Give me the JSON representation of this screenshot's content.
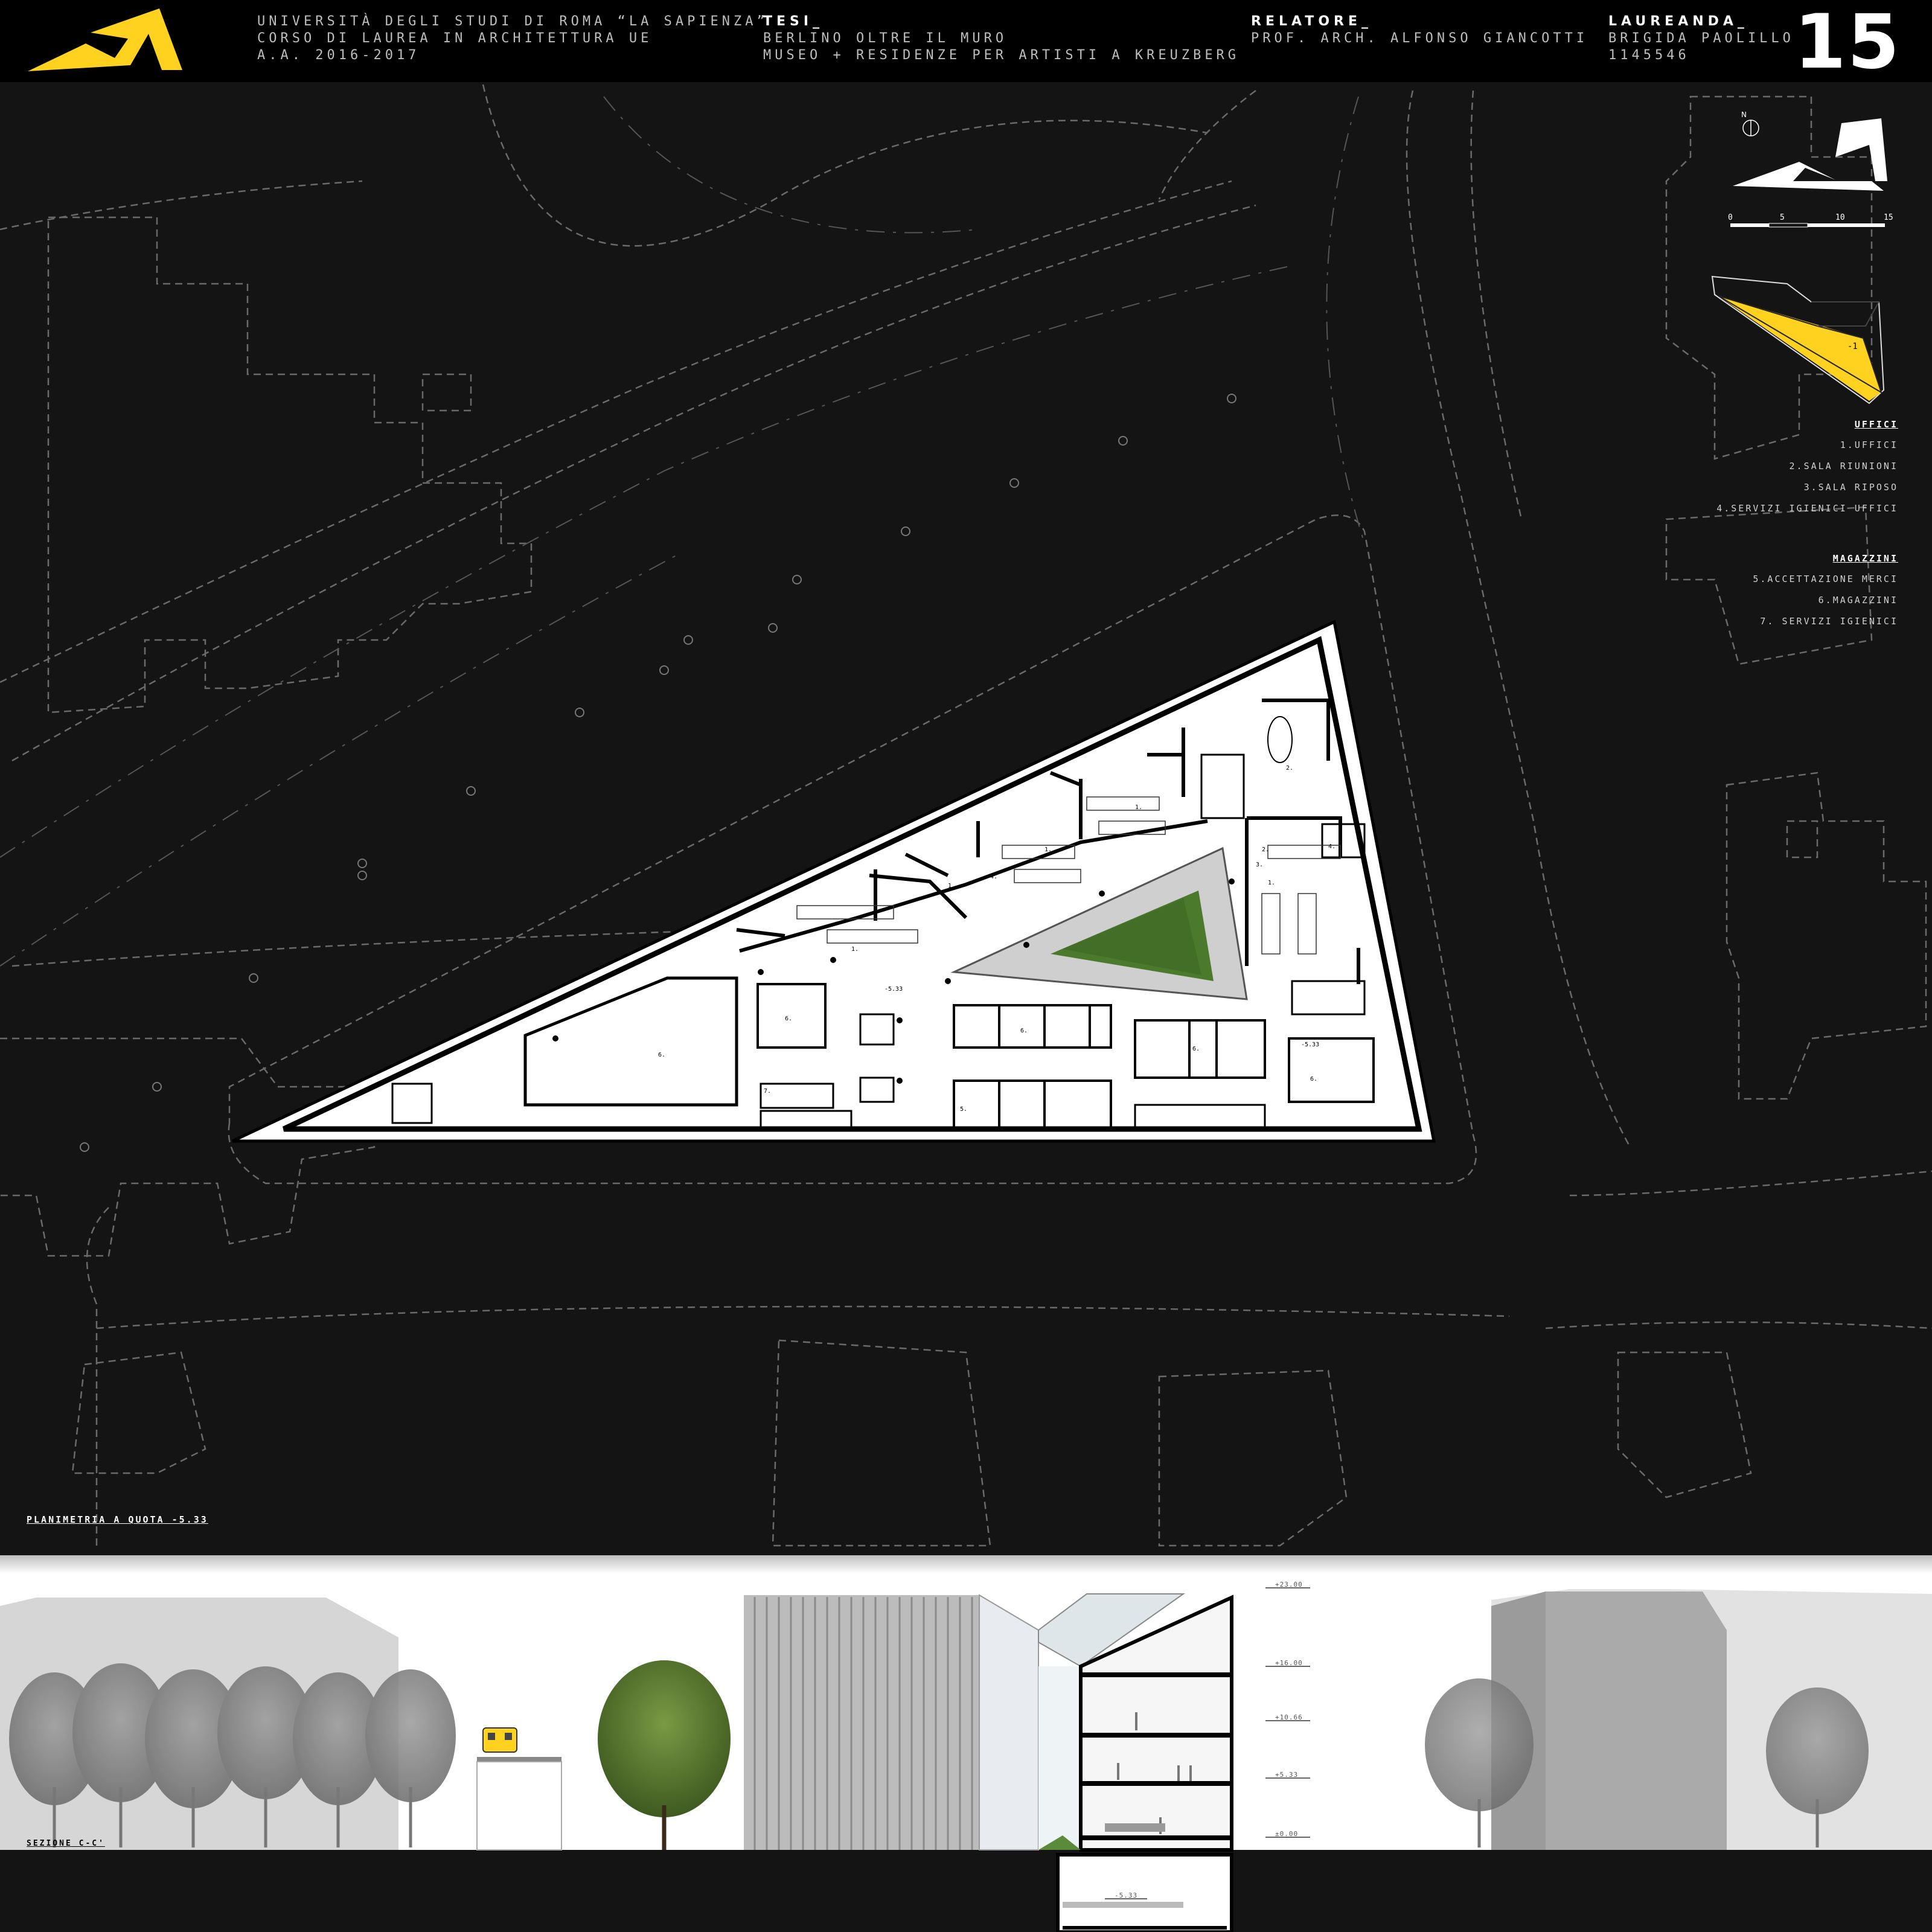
{
  "header": {
    "university": [
      "UNIVERSITÀ DEGLI STUDI DI ROMA “LA SAPIENZA”",
      "CORSO DI LAUREA IN ARCHITETTURA UE",
      "A.A. 2016-2017"
    ],
    "tesi_heading": "TESI_",
    "tesi_lines": [
      "BERLINO OLTRE IL MURO",
      "MUSEO + RESIDENZE PER ARTISTI A KREUZBERG"
    ],
    "relatore_heading": "RELATORE_",
    "relatore_name": "PROF. ARCH. ALFONSO GIANCOTTI",
    "laureanda_heading": "LAUREANDA_",
    "laureanda_name": "BRIGIDA PAOLILLO",
    "laureanda_id": "1145546",
    "page_number": "15"
  },
  "scale_bar": {
    "north": "N",
    "ticks": [
      "0",
      "5",
      "10",
      "15"
    ]
  },
  "key_plan": {
    "level": "-1"
  },
  "legend": {
    "uffici_heading": "UFFICI",
    "uffici_items": [
      "1.UFFICI",
      "2.SALA RIUNIONI",
      "3.SALA RIPOSO",
      "4.SERVIZI IGIENICI UFFICI"
    ],
    "magazzini_heading": "MAGAZZINI",
    "magazzini_items": [
      "5.ACCETTAZIONE MERCI",
      "6.MAGAZZINI",
      "7. SERVIZI IGIENICI"
    ]
  },
  "plan": {
    "caption": "PLANIMETRIA A QUOTA -5.33",
    "level_marks": [
      "-5.33",
      "-5.33"
    ],
    "room_labels": [
      "1.",
      "1.",
      "1.",
      "1.",
      "1.",
      "2.",
      "2.",
      "3.",
      "4.",
      "4.",
      "5.",
      "6.",
      "6.",
      "6.",
      "6.",
      "6.",
      "7."
    ]
  },
  "section": {
    "caption": "SEZIONE C-C'",
    "levels": [
      "+23.00",
      "+16.00",
      "+10.66",
      "+5.33",
      "±0.00",
      "-5.33"
    ]
  },
  "colors": {
    "accent": "#ffd21f",
    "background": "#141414",
    "header": "#000000",
    "courtyard_green": "#4c7a2c"
  }
}
